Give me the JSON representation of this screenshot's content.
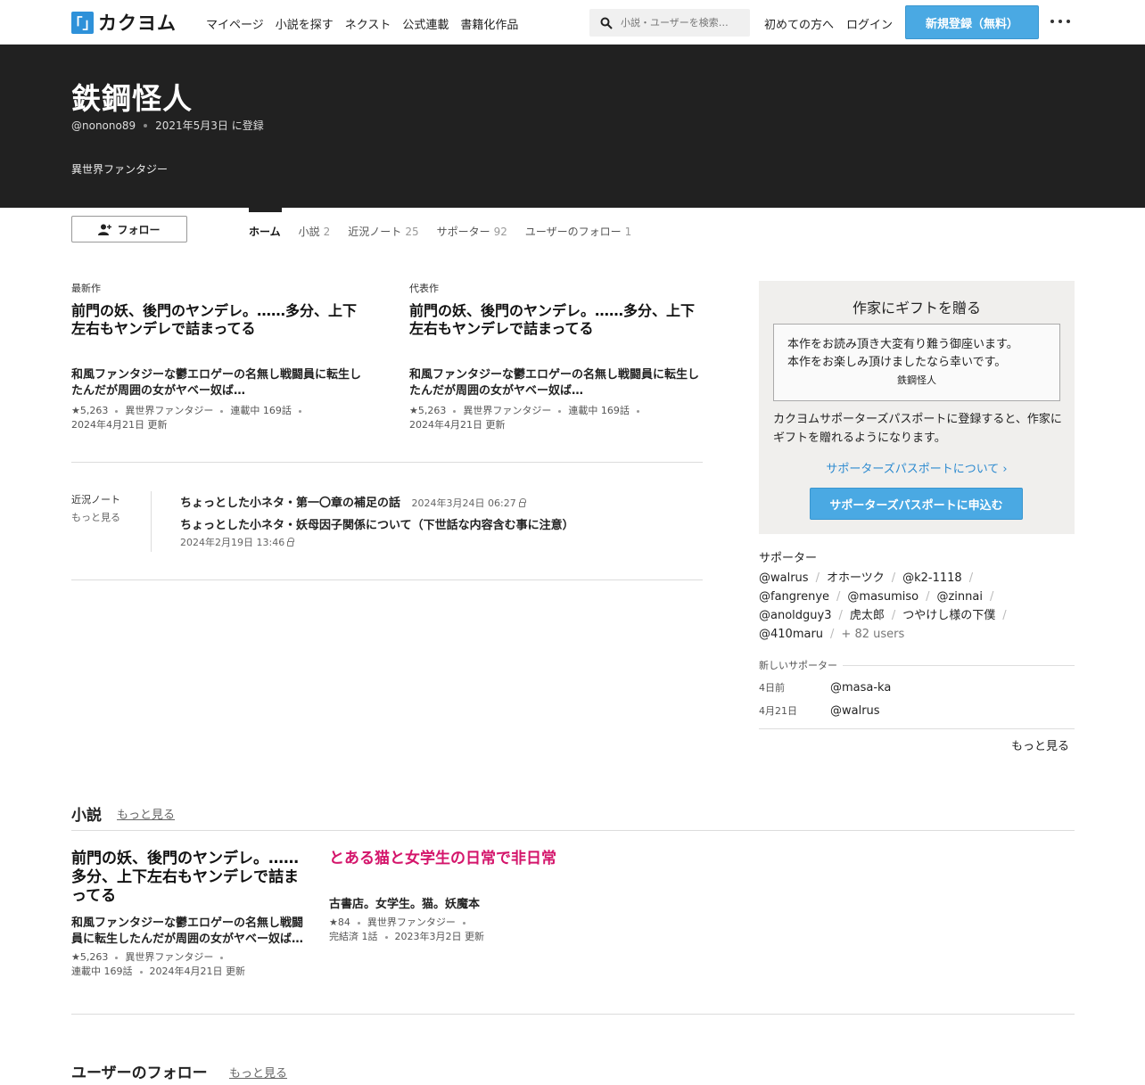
{
  "header": {
    "logo_mark": "「」",
    "logo_text": "カクヨム",
    "nav": [
      "マイページ",
      "小説を探す",
      "ネクスト",
      "公式連載",
      "書籍化作品"
    ],
    "search_placeholder": "小説・ユーザーを検索…",
    "first_time": "初めての方へ",
    "login": "ログイン",
    "signup": "新規登録（無料）"
  },
  "profile": {
    "name": "鉄鋼怪人",
    "handle": "@nonono89",
    "registered": "2021年5月3日 に登録",
    "genre": "異世界ファンタジー",
    "follow_label": "フォロー"
  },
  "tabs": [
    {
      "label": "ホーム",
      "count": ""
    },
    {
      "label": "小説",
      "count": "2"
    },
    {
      "label": "近況ノート",
      "count": "25"
    },
    {
      "label": "サポーター",
      "count": "92"
    },
    {
      "label": "ユーザーのフォロー",
      "count": "1"
    }
  ],
  "latest": {
    "label": "最新作",
    "title": "前門の妖、後門のヤンデレ。……多分、上下左右もヤンデレで詰まってる",
    "catch": "和風ファンタジーな鬱エロゲーの名無し戦闘員に転生したんだが周囲の女がヤベー奴ば…",
    "stars": "★5,263",
    "genre": "異世界ファンタジー",
    "status": "連載中 169話",
    "updated": "2024年4月21日 更新"
  },
  "featured": {
    "label": "代表作",
    "title": "前門の妖、後門のヤンデレ。……多分、上下左右もヤンデレで詰まってる",
    "catch": "和風ファンタジーな鬱エロゲーの名無し戦闘員に転生したんだが周囲の女がヤベー奴ば…",
    "stars": "★5,263",
    "genre": "異世界ファンタジー",
    "status": "連載中 169話",
    "updated": "2024年4月21日 更新"
  },
  "notes": {
    "label": "近況ノート",
    "more": "もっと見る",
    "items": [
      {
        "title": "ちょっとした小ネタ・第一〇章の補足の話",
        "date": "2024年3月24日 06:27"
      },
      {
        "title": "ちょっとした小ネタ・妖母因子関係について（下世話な内容含む事に注意）",
        "date": "2024年2月19日 13:46"
      }
    ]
  },
  "gift": {
    "title": "作家にギフトを贈る",
    "message_line1": "本作をお読み頂き大変有り難う御座います。",
    "message_line2": "本作をお楽しみ頂けましたなら幸いです。",
    "signature": "鉄鋼怪人",
    "desc": "カクヨムサポーターズパスポートに登録すると、作家にギフトを贈れるようになります。",
    "about": "サポーターズパスポートについて ›",
    "apply": "サポーターズパスポートに申込む"
  },
  "supporters": {
    "title": "サポーター",
    "list": [
      "@walrus",
      "オホーツク",
      "@k2-1118",
      "@fangrenye",
      "@masumiso",
      "@zinnai",
      "@anoldguy3",
      "虎太郎",
      "つやけし様の下僕",
      "@410maru"
    ],
    "more_users": "+ 82 users",
    "new_title": "新しいサポーター",
    "new": [
      {
        "date": "4日前",
        "user": "@masa-ka"
      },
      {
        "date": "4月21日",
        "user": "@walrus"
      }
    ],
    "more": "もっと見る"
  },
  "novels": {
    "title": "小説",
    "more": "もっと見る",
    "items": [
      {
        "title": "前門の妖、後門のヤンデレ。……多分、上下左右もヤンデレで詰まってる",
        "catch": "和風ファンタジーな鬱エロゲーの名無し戦闘員に転生したんだが周囲の女がヤベー奴ば…",
        "stars": "★5,263",
        "genre": "異世界ファンタジー",
        "status": "連載中 169話",
        "updated": "2024年4月21日 更新"
      },
      {
        "title": "とある猫と女学生の日常で非日常",
        "catch": "古書店。女学生。猫。妖魔本",
        "stars": "★84",
        "genre": "異世界ファンタジー",
        "status": "完結済 1話",
        "updated": "2023年3月2日 更新"
      }
    ]
  },
  "user_follows": {
    "title": "ユーザーのフォロー",
    "more": "もっと見る"
  },
  "colors": {
    "accent_blue": "#4aa9e3",
    "link_blue": "#2e8bd0",
    "hero_bg": "#212121",
    "pink_title": "#d4156b"
  }
}
